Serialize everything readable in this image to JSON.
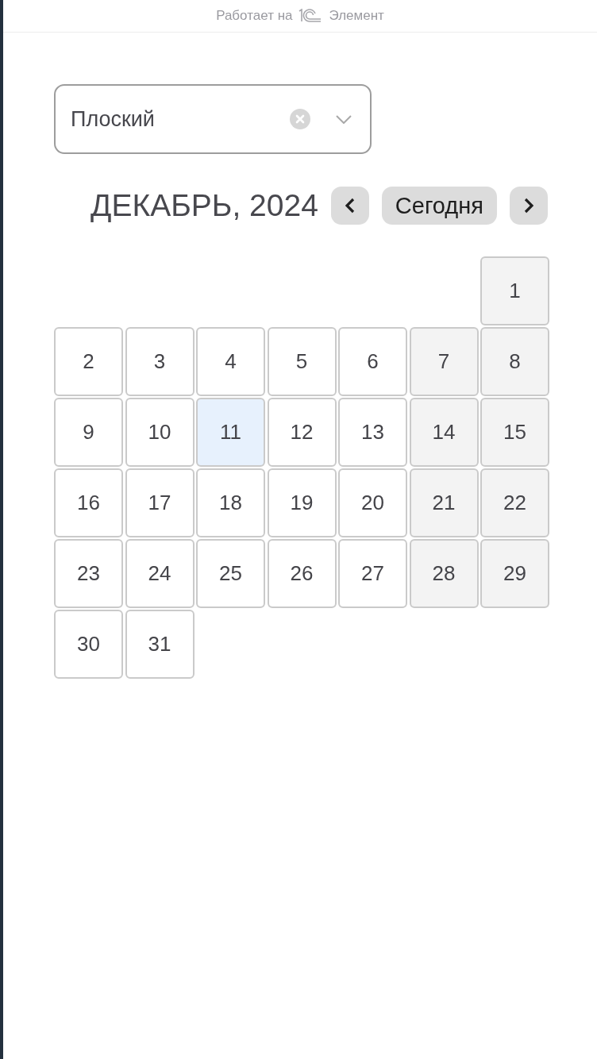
{
  "powered_by": {
    "prefix": "Работает на",
    "product": "Элемент"
  },
  "select": {
    "value": "Плоский",
    "clearable": true
  },
  "calendar": {
    "title": "ДЕКАБРЬ, 2024",
    "today_button": "Сегодня",
    "weeks": [
      {
        "days": [
          {
            "kind": "empty"
          },
          {
            "kind": "empty"
          },
          {
            "kind": "empty"
          },
          {
            "kind": "empty"
          },
          {
            "kind": "empty"
          },
          {
            "kind": "empty"
          },
          {
            "kind": "day",
            "label": "1",
            "weekend": true,
            "today": false
          }
        ]
      },
      {
        "days": [
          {
            "kind": "day",
            "label": "2",
            "weekend": false,
            "today": false
          },
          {
            "kind": "day",
            "label": "3",
            "weekend": false,
            "today": false
          },
          {
            "kind": "day",
            "label": "4",
            "weekend": false,
            "today": false
          },
          {
            "kind": "day",
            "label": "5",
            "weekend": false,
            "today": false
          },
          {
            "kind": "day",
            "label": "6",
            "weekend": false,
            "today": false
          },
          {
            "kind": "day",
            "label": "7",
            "weekend": true,
            "today": false
          },
          {
            "kind": "day",
            "label": "8",
            "weekend": true,
            "today": false
          }
        ]
      },
      {
        "days": [
          {
            "kind": "day",
            "label": "9",
            "weekend": false,
            "today": false
          },
          {
            "kind": "day",
            "label": "10",
            "weekend": false,
            "today": false
          },
          {
            "kind": "day",
            "label": "11",
            "weekend": false,
            "today": true
          },
          {
            "kind": "day",
            "label": "12",
            "weekend": false,
            "today": false
          },
          {
            "kind": "day",
            "label": "13",
            "weekend": false,
            "today": false
          },
          {
            "kind": "day",
            "label": "14",
            "weekend": true,
            "today": false
          },
          {
            "kind": "day",
            "label": "15",
            "weekend": true,
            "today": false
          }
        ]
      },
      {
        "days": [
          {
            "kind": "day",
            "label": "16",
            "weekend": false,
            "today": false
          },
          {
            "kind": "day",
            "label": "17",
            "weekend": false,
            "today": false
          },
          {
            "kind": "day",
            "label": "18",
            "weekend": false,
            "today": false
          },
          {
            "kind": "day",
            "label": "19",
            "weekend": false,
            "today": false
          },
          {
            "kind": "day",
            "label": "20",
            "weekend": false,
            "today": false
          },
          {
            "kind": "day",
            "label": "21",
            "weekend": true,
            "today": false
          },
          {
            "kind": "day",
            "label": "22",
            "weekend": true,
            "today": false
          }
        ]
      },
      {
        "days": [
          {
            "kind": "day",
            "label": "23",
            "weekend": false,
            "today": false
          },
          {
            "kind": "day",
            "label": "24",
            "weekend": false,
            "today": false
          },
          {
            "kind": "day",
            "label": "25",
            "weekend": false,
            "today": false
          },
          {
            "kind": "day",
            "label": "26",
            "weekend": false,
            "today": false
          },
          {
            "kind": "day",
            "label": "27",
            "weekend": false,
            "today": false
          },
          {
            "kind": "day",
            "label": "28",
            "weekend": true,
            "today": false
          },
          {
            "kind": "day",
            "label": "29",
            "weekend": true,
            "today": false
          }
        ]
      },
      {
        "days": [
          {
            "kind": "day",
            "label": "30",
            "weekend": false,
            "today": false
          },
          {
            "kind": "day",
            "label": "31",
            "weekend": false,
            "today": false
          }
        ]
      }
    ]
  }
}
